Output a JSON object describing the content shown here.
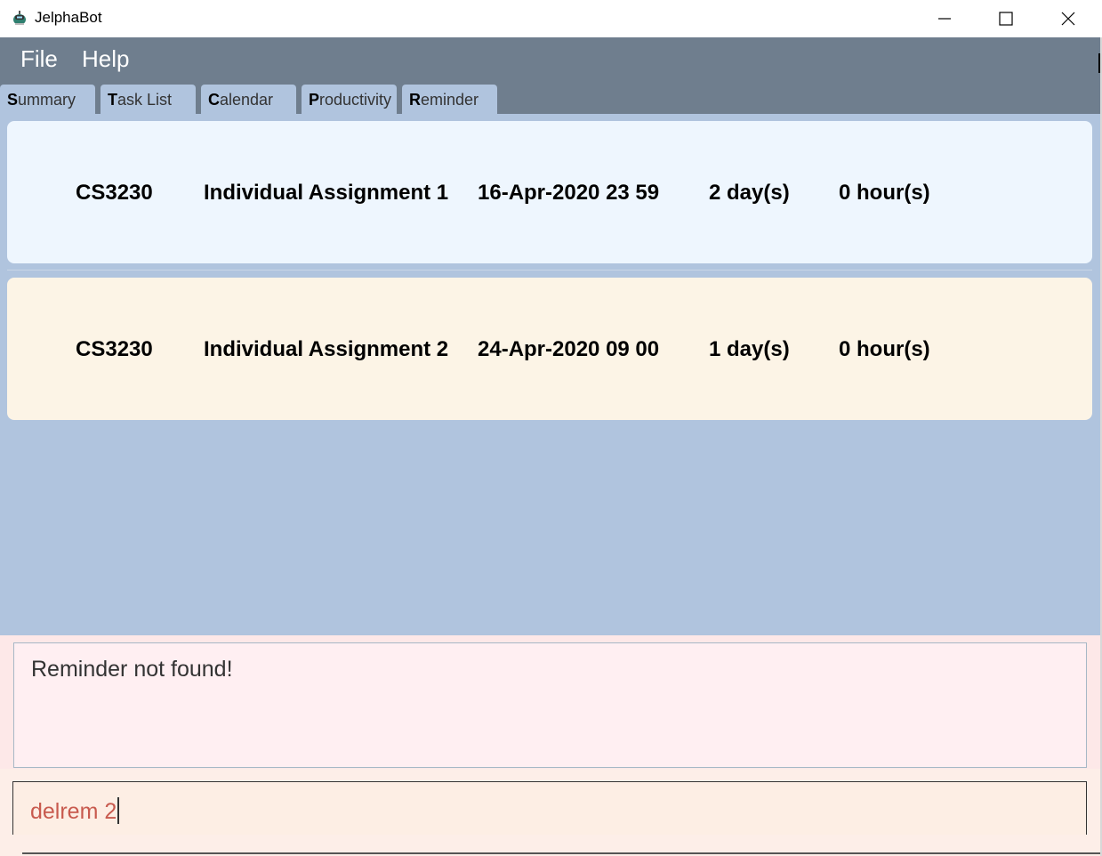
{
  "window": {
    "title": "JelphaBot"
  },
  "menu": {
    "items": [
      "File",
      "Help"
    ]
  },
  "tabs": [
    {
      "accel": "S",
      "rest": "ummary"
    },
    {
      "accel": "T",
      "rest": "ask List"
    },
    {
      "accel": "C",
      "rest": "alendar"
    },
    {
      "accel": "P",
      "rest": "roductivity"
    },
    {
      "accel": "R",
      "rest": "eminder"
    }
  ],
  "reminders": [
    {
      "module": "CS3230",
      "description": "Individual Assignment 1",
      "date": "16-Apr-2020 23 59",
      "days": "2 day(s)",
      "hours": "0 hour(s)"
    },
    {
      "module": "CS3230",
      "description": "Individual Assignment 2",
      "date": "24-Apr-2020 09 00",
      "days": "1 day(s)",
      "hours": "0 hour(s)"
    }
  ],
  "result": {
    "text": "Reminder not found!"
  },
  "command": {
    "value": "delrem 2"
  },
  "colors": {
    "menubar": "#6f7e8e",
    "content": "#b0c4de",
    "card1": "#eef6fe",
    "card2": "#fcf4e6",
    "result_bg": "#ffeff2",
    "command_text": "#c85a4e"
  },
  "icons": [
    "jelphabot-app-icon",
    "minimize-icon",
    "maximize-icon",
    "close-icon"
  ]
}
